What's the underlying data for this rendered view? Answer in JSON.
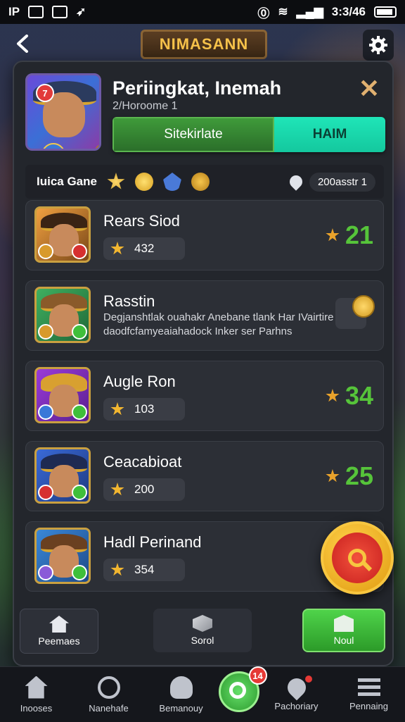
{
  "status_bar": {
    "left_text": "IP",
    "time": "3:3/46"
  },
  "header": {
    "title": "NIMASANN"
  },
  "profile": {
    "rank_badge": "7",
    "name": "Periingkat, Inemah",
    "subtitle": "2/Horoome 1",
    "xp_fraction": 0.6,
    "tabs": [
      {
        "label": "Sitekirlate"
      },
      {
        "label": "HAIM"
      }
    ]
  },
  "filter": {
    "label": "Iuica Gane",
    "count": "200asstr 1"
  },
  "players": [
    {
      "name": "Rears Siod",
      "score": "432",
      "rank": "21"
    },
    {
      "name": "Rasstin",
      "description": "Degjanshtlak ouahakr Anebane tlank Har IVairtire daodfcfamyeaiahadock Inker ser Parhns"
    },
    {
      "name": "Augle Ron",
      "score": "103",
      "rank": "34"
    },
    {
      "name": "Ceacabioat",
      "score": "200",
      "rank": "25"
    },
    {
      "name": "Hadl Perinand",
      "score": "354"
    }
  ],
  "actions": [
    {
      "label": "Peemaes"
    },
    {
      "label": "Sorol"
    },
    {
      "label": "Noul"
    }
  ],
  "bottom_nav": {
    "items": [
      {
        "label": "Inooses"
      },
      {
        "label": "Nanehafe"
      },
      {
        "label": "Bemanouy"
      },
      {
        "label": "Pachoriary"
      },
      {
        "label": "Pennaing"
      }
    ],
    "center_badge": "14"
  },
  "colors": {
    "accent_green": "#56c43a",
    "tab_teal": "#1fe5b8",
    "title_gold": "#f6c24a",
    "fab_red": "#e53935"
  },
  "icons": {
    "back": "chevron-left-icon",
    "settings": "gear-icon",
    "close": "close-icon",
    "star": "star-icon",
    "coin": "coin-icon",
    "search": "search-icon"
  }
}
